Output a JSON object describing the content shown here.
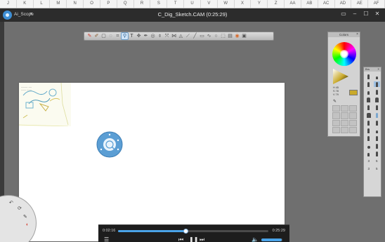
{
  "spreadsheet_columns": [
    "J",
    "K",
    "L",
    "M",
    "N",
    "O",
    "P",
    "Q",
    "R",
    "S",
    "T",
    "U",
    "V",
    "W",
    "X",
    "Y",
    "Z",
    "AA",
    "AB",
    "AC",
    "AD",
    "AE",
    "AF"
  ],
  "window": {
    "app_name": "Ai_Scope",
    "app_menu_glyph": "▾",
    "title": "C_Dig_Sketch.CAM (0:25:29)",
    "controls": [
      "▭",
      "–",
      "☐",
      "✕"
    ]
  },
  "toolbar": {
    "tools": [
      {
        "name": "brush-icon",
        "glyph": "✎",
        "color": "#d23a2a"
      },
      {
        "name": "smudge-icon",
        "glyph": "✐",
        "color": "#8a5c2f"
      },
      {
        "name": "select-icon",
        "glyph": "▢",
        "color": "#555555"
      },
      {
        "name": "lasso-icon",
        "glyph": "◌",
        "color": "#555555"
      },
      {
        "name": "crop-icon",
        "glyph": "⌗",
        "color": "#555555"
      },
      {
        "name": "zoom-icon",
        "glyph": "⚲",
        "color": "#2d5f8f",
        "active": true
      },
      {
        "name": "text-icon",
        "glyph": "T",
        "color": "#333333"
      },
      {
        "name": "move-icon",
        "glyph": "✥",
        "color": "#555555"
      },
      {
        "name": "pen-icon",
        "glyph": "✒",
        "color": "#555555"
      },
      {
        "name": "target-icon",
        "glyph": "◎",
        "color": "#555555"
      },
      {
        "name": "fill-icon",
        "glyph": "⌽",
        "color": "#555555"
      },
      {
        "name": "transform-icon",
        "glyph": "⤧",
        "color": "#555555"
      },
      {
        "name": "symmetry-icon",
        "glyph": "⋈",
        "color": "#555555"
      },
      {
        "name": "perspective-icon",
        "glyph": "◬",
        "color": "#555555"
      },
      {
        "name": "ruler-icon",
        "glyph": "⟋",
        "color": "#555555"
      },
      {
        "name": "line-icon",
        "glyph": "╱",
        "color": "#555555"
      },
      {
        "name": "rectangle-icon",
        "glyph": "▭",
        "color": "#555555"
      },
      {
        "name": "curve-icon",
        "glyph": "∿",
        "color": "#555555"
      },
      {
        "name": "ellipse-icon",
        "glyph": "○",
        "color": "#555555"
      },
      {
        "name": "stamp-icon",
        "glyph": "⬚",
        "color": "#555555"
      },
      {
        "name": "layers-icon",
        "glyph": "▤",
        "color": "#555555"
      },
      {
        "name": "color-wheel-icon",
        "glyph": "◉",
        "color": "#d86a2b"
      },
      {
        "name": "image-icon",
        "glyph": "▣",
        "color": "#555555"
      }
    ]
  },
  "color_panel": {
    "title": "Colors",
    "close_glyph": "×",
    "readouts": [
      "H  45",
      "S  78",
      "V  79"
    ],
    "current_color": "#c9a92a",
    "eyedropper_glyph": "✎"
  },
  "brush_panel": {
    "title": "Brs",
    "close_glyph": "×",
    "sizes": [
      "3",
      "5",
      "3",
      "5"
    ]
  },
  "playback": {
    "current_time": "0:02:16",
    "total_time": "0:25:29",
    "progress_fraction": 0.45,
    "volume_fraction": 0.95,
    "buttons": {
      "menu": "☰",
      "rewind": "⏮",
      "play_pause": "❚❚",
      "forward": "⏭",
      "volume": "🔈"
    }
  },
  "left_lagoon": {
    "labels": [
      "↶",
      "⟳",
      "✎",
      "◐"
    ]
  },
  "colors": {
    "titlebar": "#2c2c2c",
    "workspace": "#6f6f6f",
    "accent": "#4aa3e8"
  }
}
